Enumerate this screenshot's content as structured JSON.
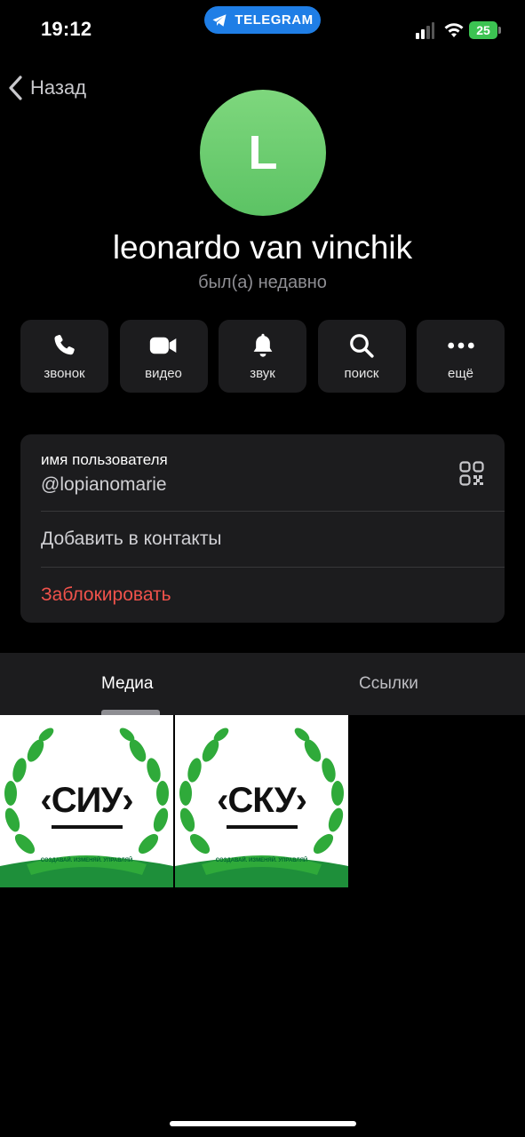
{
  "status_bar": {
    "time": "19:12",
    "app_pill": "TELEGRAM",
    "battery": "25"
  },
  "nav": {
    "back_label": "Назад"
  },
  "profile": {
    "avatar_letter": "L",
    "name": "leonardo van vinchik",
    "last_seen": "был(а) недавно"
  },
  "actions": [
    {
      "label": "звонок",
      "icon": "phone-icon"
    },
    {
      "label": "видео",
      "icon": "video-icon"
    },
    {
      "label": "звук",
      "icon": "bell-icon"
    },
    {
      "label": "поиск",
      "icon": "search-icon"
    },
    {
      "label": "ещё",
      "icon": "more-icon"
    }
  ],
  "info": {
    "username_caption": "имя пользователя",
    "username_value": "@lopianomarie",
    "add_contact": "Добавить в контакты",
    "block": "Заблокировать"
  },
  "tabs": {
    "media": "Медиа",
    "links": "Ссылки"
  },
  "media": [
    {
      "logo_text": "‹СИУ›",
      "ribbon": "СОЗДАВАЙ. ИЗМЕНЯЙ. УПРАВЛЯЙ"
    },
    {
      "logo_text": "‹СКУ›",
      "ribbon": "СОЗДАВАЙ. ИЗМЕНЯЙ. УПРАВЛЯЙ"
    }
  ],
  "colors": {
    "accent_blue": "#1f7ee6",
    "avatar_green": "#6ccd6f",
    "danger_red": "#f0524b",
    "card_bg": "#1c1c1e",
    "laurel_green": "#2faa3a"
  }
}
